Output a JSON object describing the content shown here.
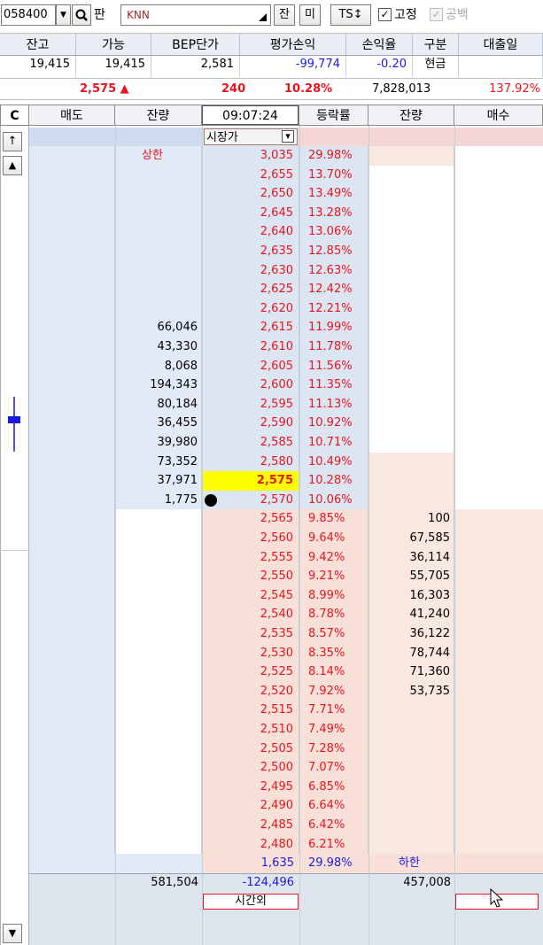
{
  "toolbar": {
    "code": "058400",
    "chart_label": "판",
    "name": "KNN",
    "jan": "잔",
    "mi": "미",
    "ts": "TS↕",
    "fixed": "고정",
    "gongbaek": "공백"
  },
  "summary": {
    "headers": [
      "잔고",
      "가능",
      "BEP단가",
      "평가손익",
      "손익율",
      "구분",
      "대출일"
    ],
    "values": [
      "19,415",
      "19,415",
      "2,581",
      "-99,774",
      "-0.20",
      "현금",
      ""
    ],
    "price": "2,575 ▲",
    "change": "240",
    "rate": "10.28%",
    "volume": "7,828,013",
    "ratio": "137.92%"
  },
  "book": {
    "headers": {
      "c": "C",
      "sell": "매도",
      "sell_qty": "잔량",
      "time": "09:07:24",
      "rate": "등락률",
      "buy_qty": "잔량",
      "buy": "매수"
    },
    "market": "시장가",
    "upper_label": "상한",
    "lower_label": "하한",
    "ask_rows": [
      {
        "qty": "",
        "price": "3,035",
        "rate": "29.98%"
      },
      {
        "qty": "",
        "price": "2,655",
        "rate": "13.70%"
      },
      {
        "qty": "",
        "price": "2,650",
        "rate": "13.49%"
      },
      {
        "qty": "",
        "price": "2,645",
        "rate": "13.28%"
      },
      {
        "qty": "",
        "price": "2,640",
        "rate": "13.06%"
      },
      {
        "qty": "",
        "price": "2,635",
        "rate": "12.85%"
      },
      {
        "qty": "",
        "price": "2,630",
        "rate": "12.63%"
      },
      {
        "qty": "",
        "price": "2,625",
        "rate": "12.42%"
      },
      {
        "qty": "",
        "price": "2,620",
        "rate": "12.21%"
      },
      {
        "qty": "66,046",
        "price": "2,615",
        "rate": "11.99%"
      },
      {
        "qty": "43,330",
        "price": "2,610",
        "rate": "11.78%"
      },
      {
        "qty": "8,068",
        "price": "2,605",
        "rate": "11.56%"
      },
      {
        "qty": "194,343",
        "price": "2,600",
        "rate": "11.35%"
      },
      {
        "qty": "80,184",
        "price": "2,595",
        "rate": "11.13%"
      },
      {
        "qty": "36,455",
        "price": "2,590",
        "rate": "10.92%"
      },
      {
        "qty": "39,980",
        "price": "2,585",
        "rate": "10.71%"
      },
      {
        "qty": "73,352",
        "price": "2,580",
        "rate": "10.49%"
      },
      {
        "qty": "37,971",
        "price": "2,575",
        "rate": "10.28%"
      },
      {
        "qty": "1,775",
        "price": "2,570",
        "rate": "10.06%"
      }
    ],
    "bid_rows": [
      {
        "price": "2,565",
        "rate": "9.85%",
        "qty": "100"
      },
      {
        "price": "2,560",
        "rate": "9.64%",
        "qty": "67,585"
      },
      {
        "price": "2,555",
        "rate": "9.42%",
        "qty": "36,114"
      },
      {
        "price": "2,550",
        "rate": "9.21%",
        "qty": "55,705"
      },
      {
        "price": "2,545",
        "rate": "8.99%",
        "qty": "16,303"
      },
      {
        "price": "2,540",
        "rate": "8.78%",
        "qty": "41,240"
      },
      {
        "price": "2,535",
        "rate": "8.57%",
        "qty": "36,122"
      },
      {
        "price": "2,530",
        "rate": "8.35%",
        "qty": "78,744"
      },
      {
        "price": "2,525",
        "rate": "8.14%",
        "qty": "71,360"
      },
      {
        "price": "2,520",
        "rate": "7.92%",
        "qty": "53,735"
      },
      {
        "price": "2,515",
        "rate": "7.71%",
        "qty": ""
      },
      {
        "price": "2,510",
        "rate": "7.49%",
        "qty": ""
      },
      {
        "price": "2,505",
        "rate": "7.28%",
        "qty": ""
      },
      {
        "price": "2,500",
        "rate": "7.07%",
        "qty": ""
      },
      {
        "price": "2,495",
        "rate": "6.85%",
        "qty": ""
      },
      {
        "price": "2,490",
        "rate": "6.64%",
        "qty": ""
      },
      {
        "price": "2,485",
        "rate": "6.42%",
        "qty": ""
      },
      {
        "price": "2,480",
        "rate": "6.21%",
        "qty": ""
      }
    ],
    "lower_price": "1,635",
    "lower_rate": "29.98%",
    "total_sell": "581,504",
    "total_diff": "-124,496",
    "total_buy": "457,008",
    "after_hours": "시간외"
  },
  "colors": {
    "ask_bg": "#e3eaf7",
    "bid_bg": "#f9e8df",
    "price_ask": "#dce6f2",
    "price_bid": "#f8e0d8",
    "highlight": "#ffff00",
    "accent_red": "#e8141e",
    "accent_blue": "#1b1be0"
  }
}
